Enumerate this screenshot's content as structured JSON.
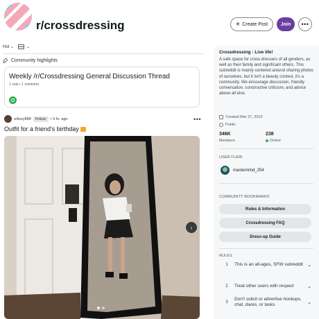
{
  "header": {
    "subreddit": "r/crossdressing",
    "create_post": "Create Post",
    "join": "Join",
    "more": "•••"
  },
  "sort": {
    "label": "Hot"
  },
  "highlights": {
    "label": "Community highlights",
    "title": "Weekly /r/Crossdressing General Discussion Thread",
    "meta": "1 vote • 1 comment"
  },
  "post": {
    "author": "u/tizzy888",
    "flair": "Felicia!",
    "time": "• 3 hr. ago",
    "more": "•••",
    "title": "Outfit for a friend's birthday"
  },
  "sidebar": {
    "name": "Crossdressing : Live life!",
    "description": "A safe space for cross-dressers of all genders, as well as their family and significant others. This subreddit is mainly centered around sharing photos of ourselves, but it isn't a beauty contest, it's a community. We encourage discussion, friendly conversation, constructive criticism, and advice above all else.",
    "created": "Created Mar 27, 2010",
    "visibility": "Public",
    "members_value": "346K",
    "members_label": "Members",
    "online_value": "238",
    "online_label": "Online",
    "user_flair_heading": "USER FLAIR",
    "flair_user": "mastermind_254",
    "bookmarks_heading": "COMMUNITY BOOKMARKS",
    "bookmarks": [
      "Rules & Information",
      "Crossdressing FAQ",
      "Dress-up Guide"
    ],
    "rules_heading": "RULES",
    "rules": [
      {
        "num": "1",
        "text": "This is an all-ages, SFW subreddit"
      },
      {
        "num": "2",
        "text": "Treat other users with respect"
      },
      {
        "num": "3",
        "text": "Don't solicit or advertise hookups, chat, dares, or tasks"
      }
    ]
  },
  "colors": {
    "join_bg": "#6a3fa0",
    "online_dot": "#2fb34f",
    "sidebar_bg": "#f6f7f8"
  }
}
